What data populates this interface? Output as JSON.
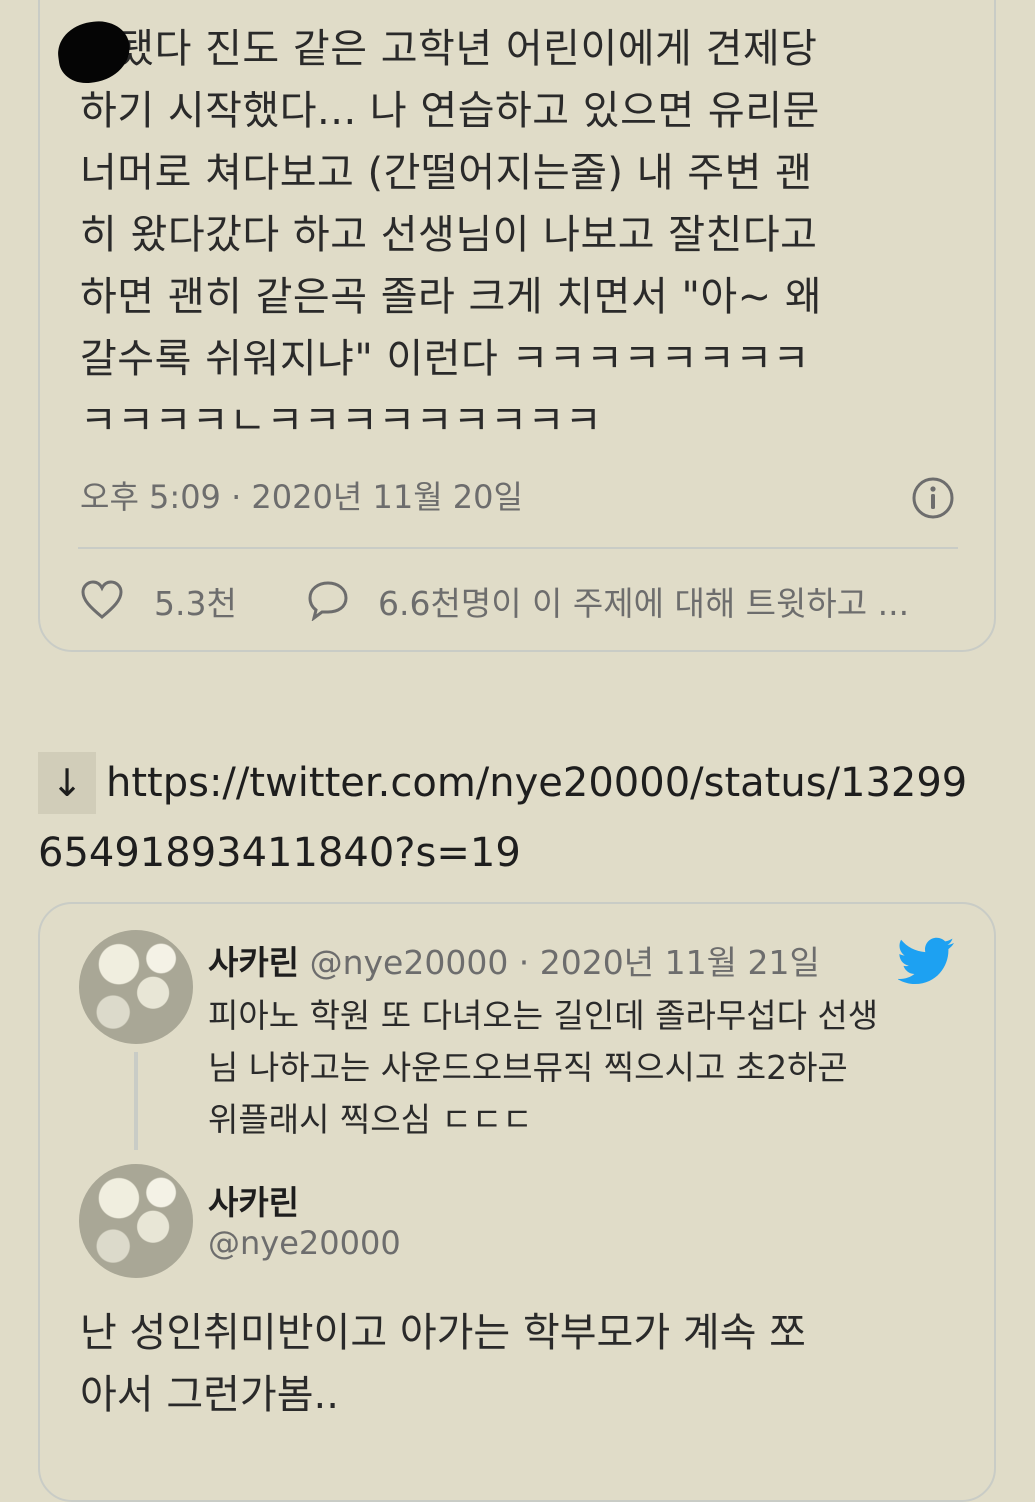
{
  "main_tweet": {
    "text_lines": [
      "돼됐다 진도 같은 고학년 어린이에게 견제당",
      "하기 시작했다... 나 연습하고 있으면 유리문",
      "너머로 쳐다보고 (간떨어지는줄) 내 주변 괜",
      "히 왔다갔다 하고 선생님이 나보고 잘친다고",
      "하면 괜히 같은곡 졸라 크게 치면서 \"아~ 왜",
      "갈수록 쉬워지냐\" 이런다 ㅋㅋㅋㅋㅋㅋㅋㅋ",
      "ㅋㅋㅋㅋㄴㅋㅋㅋㅋㅋㅋㅋㅋㅋ"
    ],
    "timestamp": "오후 5:09 · 2020년 11월 20일",
    "like_count": "5.3천",
    "reply_text": "6.6천명이 이 주제에 대해 트윗하고 ..."
  },
  "link": {
    "arrow": "↓",
    "url_line1": "https://twitter.com/nye20000/status/13299",
    "url_line2": "65491893411840?s=19"
  },
  "quoted_tweet": {
    "name": "사카린",
    "handle_date": "@nye20000 · 2020년 11월 21일",
    "text_lines": [
      "피아노 학원 또 다녀오는 길인데 졸라무섭다 선생",
      "님 나하고는 사운드오브뮤직 찍으시고 초2하곤",
      "위플래시 찍으심 ㄷㄷㄷ"
    ]
  },
  "reply_tweet": {
    "name": "사카린",
    "handle": "@nye20000",
    "text_lines": [
      "난 성인취미반이고 아가는 학부모가 계속 쪼",
      "아서 그런가봄.."
    ]
  },
  "colors": {
    "background": "#e0dcc8",
    "muted_text": "#6d6d6d",
    "border": "#c9ccc6",
    "twitter_blue": "#1da1f2"
  }
}
